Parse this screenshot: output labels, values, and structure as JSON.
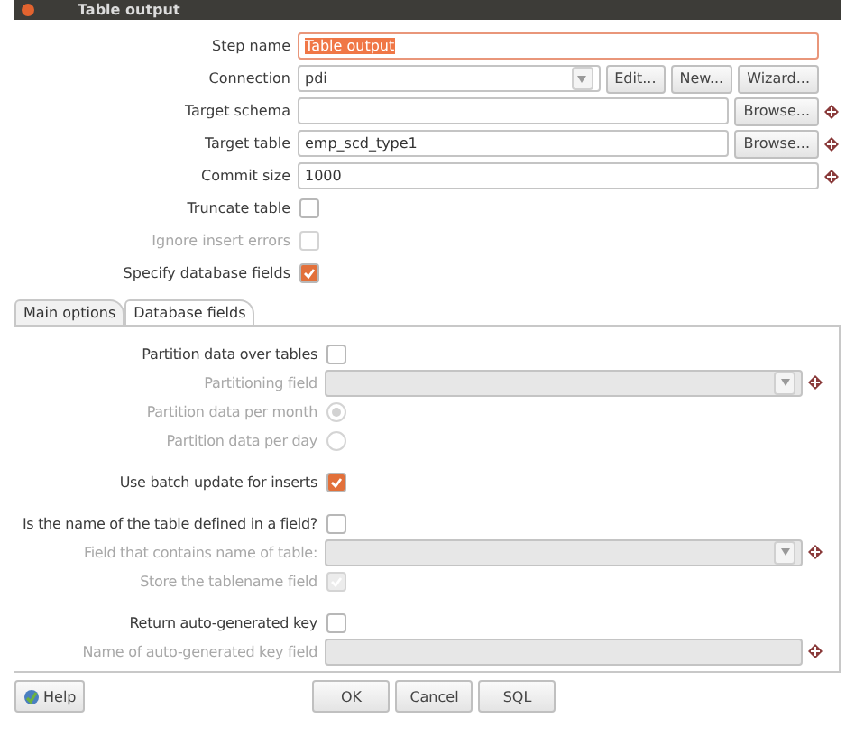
{
  "window": {
    "title": "Table output"
  },
  "top_rows": [
    {
      "label": "Step name",
      "kind": "text",
      "value": "Table output",
      "highlighted": true,
      "disabled": false
    },
    {
      "label": "Connection",
      "kind": "combo",
      "value": "pdi",
      "disabled": false,
      "buttons": [
        "Edit...",
        "New...",
        "Wizard..."
      ]
    },
    {
      "label": "Target schema",
      "kind": "text",
      "variable": true,
      "disabled": false,
      "buttons": [
        "Browse..."
      ]
    },
    {
      "label": "Target table",
      "kind": "text",
      "value": "emp_scd_type1",
      "variable": true,
      "disabled": false,
      "buttons": [
        "Browse..."
      ]
    },
    {
      "label": "Commit size",
      "kind": "text",
      "value": "1000",
      "variable": true,
      "disabled": false
    },
    {
      "label": "Truncate table",
      "kind": "checkbox",
      "checked": false,
      "disabled": false
    },
    {
      "label": "Ignore insert errors",
      "kind": "checkbox",
      "checked": false,
      "disabled": true
    },
    {
      "label": "Specify database fields",
      "kind": "checkbox",
      "checked": true,
      "disabled": false
    }
  ],
  "tabs": [
    {
      "label": "Main options",
      "selected": true
    },
    {
      "label": "Database fields",
      "selected": false
    }
  ],
  "groups": [
    [
      {
        "label": "Partition data over tables",
        "kind": "checkbox",
        "checked": false,
        "disabled": false
      },
      {
        "label": "Partitioning field",
        "kind": "combo",
        "variable": true,
        "disabled": true
      },
      {
        "label": "Partition data per month",
        "kind": "radio",
        "selected": true,
        "disabled": true
      },
      {
        "label": "Partition data per day",
        "kind": "radio",
        "selected": false,
        "disabled": true
      }
    ],
    [
      {
        "label": "Use batch update for inserts",
        "kind": "checkbox",
        "checked": true,
        "disabled": false
      }
    ],
    [
      {
        "label": "Is the name of the table defined in a field?",
        "kind": "checkbox",
        "checked": false,
        "disabled": false
      },
      {
        "label": "Field that contains name of table:",
        "kind": "combo",
        "variable": true,
        "disabled": true
      },
      {
        "label": "Store the tablename field",
        "kind": "checkbox",
        "checked": true,
        "disabled": true
      }
    ],
    [
      {
        "label": "Return auto-generated key",
        "kind": "checkbox",
        "checked": false,
        "disabled": false
      },
      {
        "label": "Name of auto-generated key field",
        "kind": "text",
        "variable": true,
        "disabled": true
      }
    ]
  ],
  "help_button": "Help",
  "buttons": [
    "OK",
    "Cancel",
    "SQL"
  ]
}
